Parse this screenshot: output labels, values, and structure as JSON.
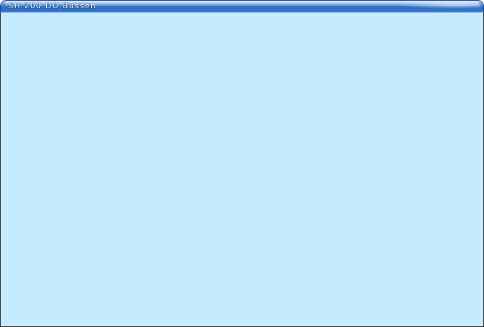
{
  "window": {
    "title": "SH 200 DO Bussen"
  },
  "colors": {
    "titlebar": "#3f7fd0",
    "content_background": "#c6ebff",
    "border": "#2b2b2b"
  }
}
